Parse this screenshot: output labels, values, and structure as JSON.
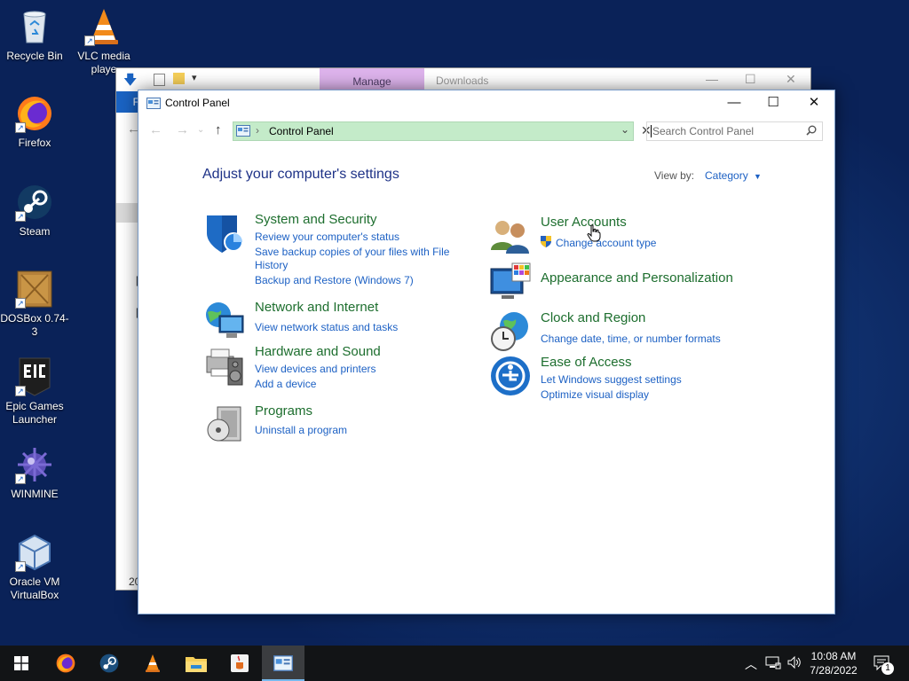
{
  "desktop": {
    "icons": [
      {
        "label": "Recycle Bin"
      },
      {
        "label": "VLC media playe"
      },
      {
        "label": "Firefox"
      },
      {
        "label": "Steam"
      },
      {
        "label": "DOSBox 0.74-3"
      },
      {
        "label": "Epic Games Launcher"
      },
      {
        "label": "WINMINE"
      },
      {
        "label": "Oracle VM VirtualBox"
      }
    ]
  },
  "background_window": {
    "ribbon_tab": "Manage",
    "title": "Downloads",
    "file_tab": "F",
    "edge_text_1": "[",
    "edge_text_2": "[",
    "status_text": "20"
  },
  "window": {
    "title": "Control Panel",
    "address": {
      "breadcrumb": "Control Panel"
    },
    "search": {
      "placeholder": "Search Control Panel"
    },
    "heading": "Adjust your computer's settings",
    "view_by": {
      "label": "View by:",
      "value": "Category"
    },
    "categories": [
      {
        "title": "System and Security",
        "links": [
          "Review your computer's status",
          "Save backup copies of your files with File",
          "History",
          "Backup and Restore (Windows 7)"
        ]
      },
      {
        "title": "Network and Internet",
        "links": [
          "View network status and tasks"
        ]
      },
      {
        "title": "Hardware and Sound",
        "links": [
          "View devices and printers",
          "Add a device"
        ]
      },
      {
        "title": "Programs",
        "links": [
          "Uninstall a program"
        ]
      },
      {
        "title": "User Accounts",
        "links": [
          "Change account type"
        ]
      },
      {
        "title": "Appearance and Personalization",
        "links": []
      },
      {
        "title": "Clock and Region",
        "links": [
          "Change date, time, or number formats"
        ]
      },
      {
        "title": "Ease of Access",
        "links": [
          "Let Windows suggest settings",
          "Optimize visual display"
        ]
      }
    ]
  },
  "taskbar": {
    "clock": {
      "time": "10:08 AM",
      "date": "7/28/2022"
    },
    "notification_count": "1"
  },
  "colors": {
    "category_title": "#1d6e2e",
    "link": "#1d61c4",
    "heading": "#1e3287",
    "address_bar": "#c4ebc9",
    "manage_tab": "#ddb3ec"
  }
}
